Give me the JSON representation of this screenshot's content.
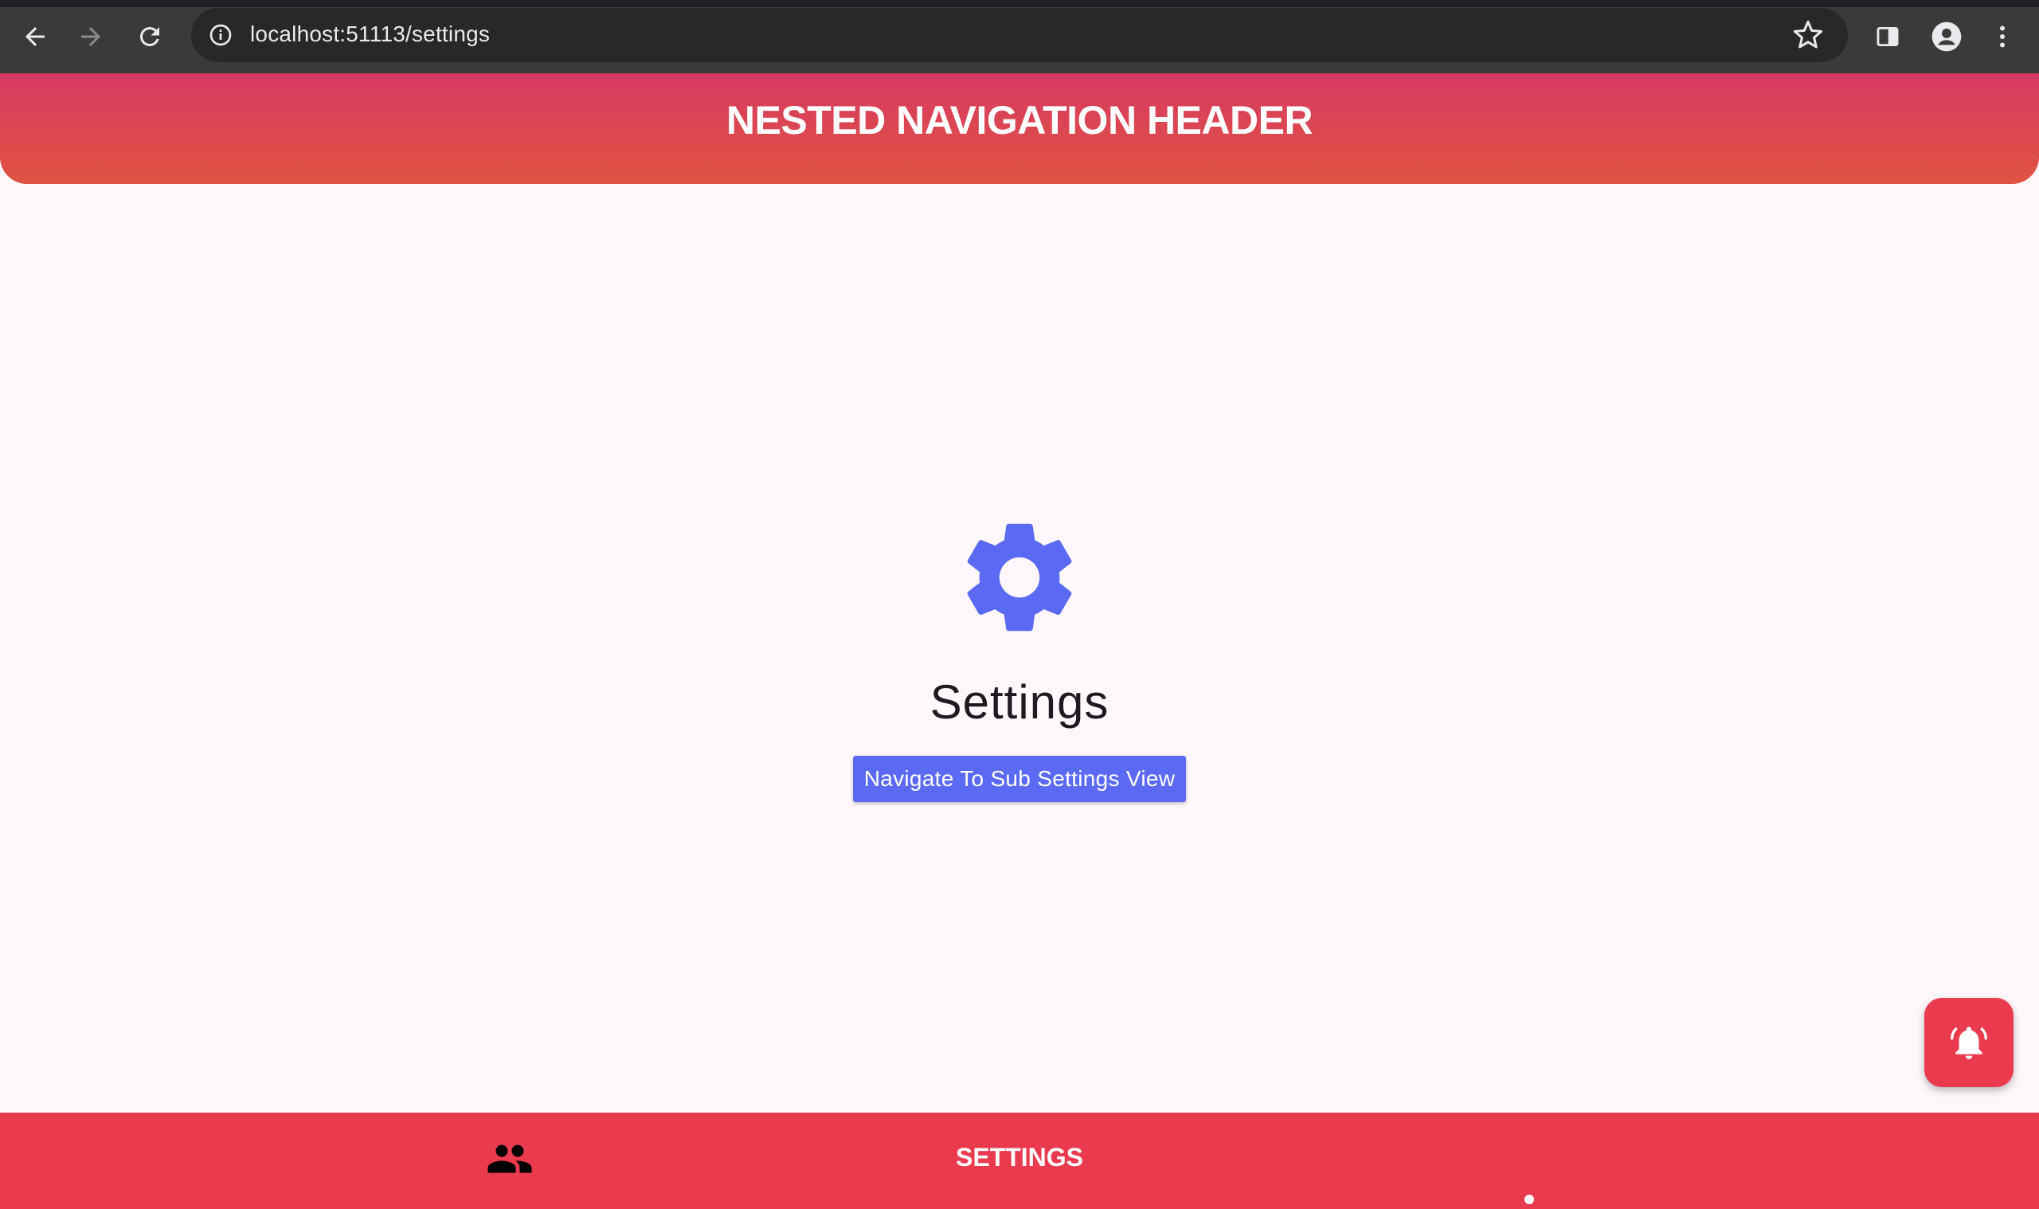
{
  "browser": {
    "url": "localhost:51113/settings",
    "icons": {
      "back": "arrow-left-icon",
      "forward": "arrow-right-icon",
      "reload": "reload-icon",
      "site_info": "info-icon",
      "bookmark": "star-icon",
      "side_panel": "side-panel-icon",
      "profile": "profile-icon",
      "menu": "kebab-menu-icon"
    }
  },
  "header": {
    "title": "NESTED NAVIGATION HEADER"
  },
  "main": {
    "icon": "gear-icon",
    "title": "Settings",
    "button_label": "Navigate To Sub Settings View"
  },
  "fab": {
    "icon": "alarm-bell-icon"
  },
  "bottom_nav": {
    "items": [
      {
        "icon": "people-icon",
        "label": ""
      },
      {
        "label": "SETTINGS",
        "active": true
      }
    ]
  },
  "colors": {
    "header_gradient_top": "#d63a63",
    "header_gradient_bottom": "#e05340",
    "accent": "#5b6af2",
    "bottom_nav": "#ea3a4d",
    "background": "#fef7fc"
  }
}
